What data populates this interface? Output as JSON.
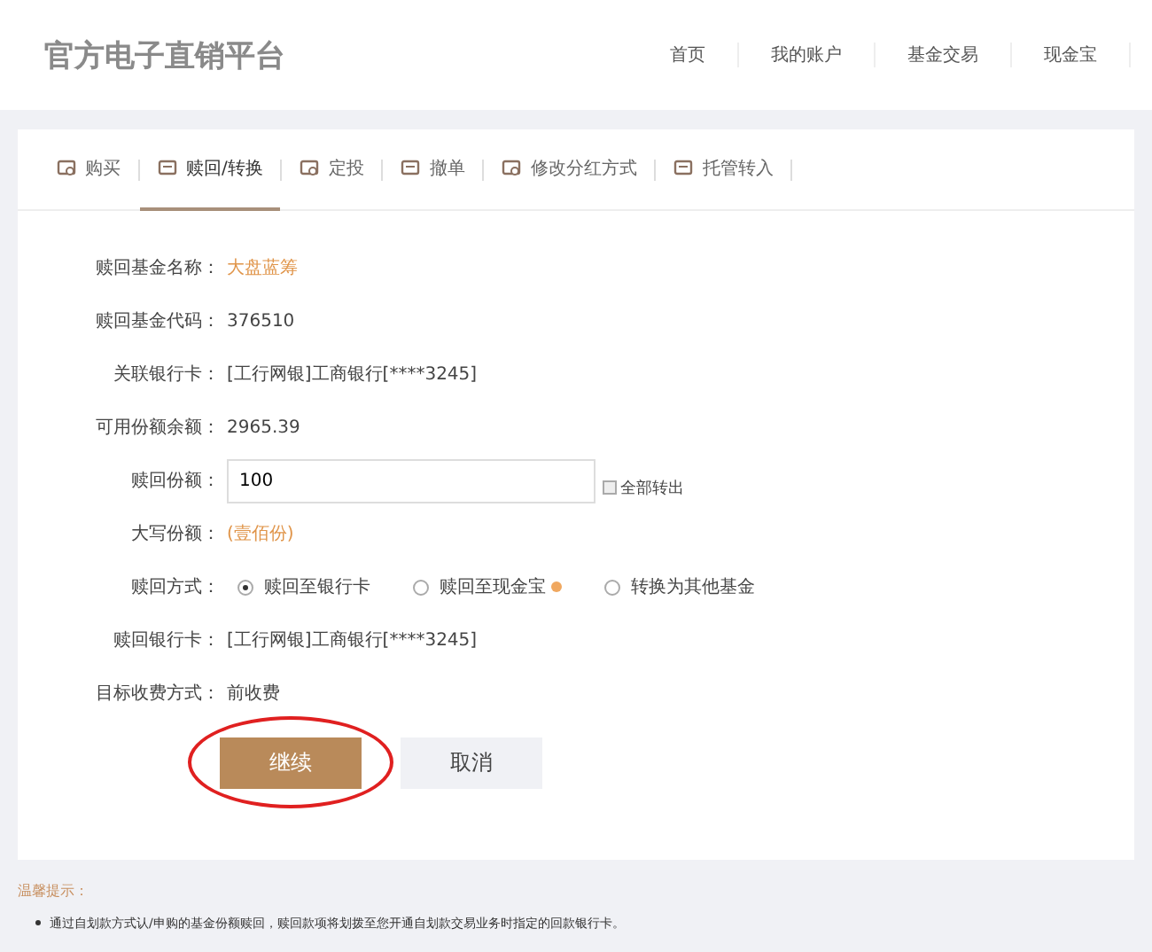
{
  "header": {
    "logo": "官方电子直销平台",
    "nav": [
      {
        "label": "首页"
      },
      {
        "label": "我的账户"
      },
      {
        "label": "基金交易"
      },
      {
        "label": "现金宝"
      }
    ]
  },
  "tabs": [
    {
      "label": "购买",
      "selected": false
    },
    {
      "label": "赎回/转换",
      "selected": true
    },
    {
      "label": "定投",
      "selected": false
    },
    {
      "label": "撤单",
      "selected": false
    },
    {
      "label": "修改分红方式",
      "selected": false
    },
    {
      "label": "托管转入",
      "selected": false
    }
  ],
  "form": {
    "rows": [
      {
        "kind": "text",
        "label": "赎回基金名称：",
        "value": "大盘蓝筹",
        "accent": true
      },
      {
        "kind": "text",
        "label": "赎回基金代码：",
        "value": "376510",
        "accent": false
      },
      {
        "kind": "text",
        "label": "关联银行卡：",
        "value": "[工行网银]工商银行[****3245]",
        "accent": false
      },
      {
        "kind": "text",
        "label": "可用份额余额：",
        "value": "2965.39",
        "accent": false
      },
      {
        "kind": "input",
        "label": "赎回份额：",
        "value": "100",
        "checkbox": {
          "label": "全部转出",
          "checked": false
        }
      },
      {
        "kind": "text",
        "label": "大写份额：",
        "value": "(壹佰份)",
        "accent": true
      },
      {
        "kind": "radio",
        "label": "赎回方式：",
        "options": [
          {
            "label": "赎回至银行卡",
            "selected": true,
            "info": false
          },
          {
            "label": "赎回至现金宝",
            "selected": false,
            "info": true
          },
          {
            "label": "转换为其他基金",
            "selected": false,
            "info": false
          }
        ]
      },
      {
        "kind": "text",
        "label": "赎回银行卡：",
        "value": "[工行网银]工商银行[****3245]",
        "accent": false
      },
      {
        "kind": "text",
        "label": "目标收费方式：",
        "value": "前收费",
        "accent": false
      }
    ],
    "buttons": [
      {
        "label": "继续",
        "primary": true,
        "circled": true
      },
      {
        "label": "取消",
        "primary": false,
        "circled": false
      }
    ]
  },
  "tips": {
    "title": "温馨提示：",
    "items": [
      "通过自划款方式认/申购的基金份额赎回，赎回款项将划拨至您开通自划款交易业务时指定的回款银行卡。"
    ]
  }
}
